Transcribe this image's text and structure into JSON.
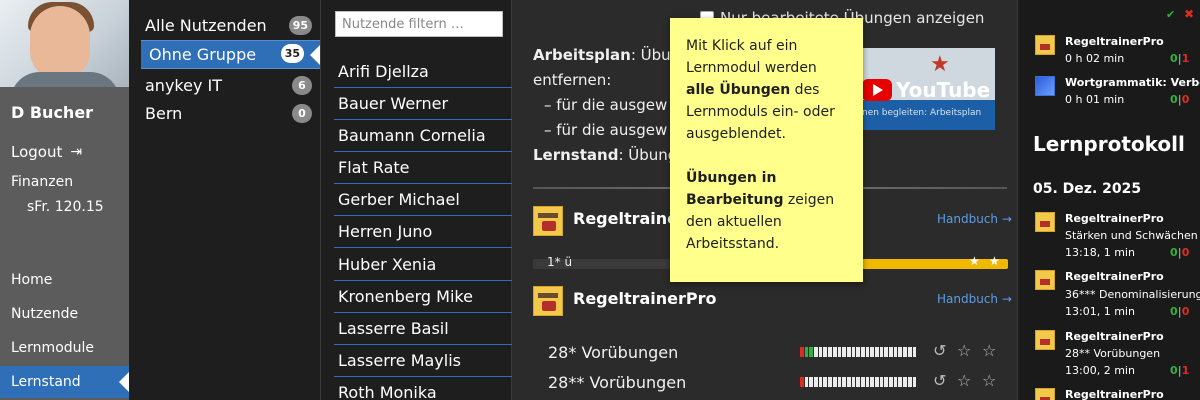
{
  "nav": {
    "user_name": "D Bucher",
    "logout_label": "Logout",
    "finance_label": "Finanzen",
    "finance_value": "sFr. 120.15",
    "items": [
      {
        "label": "Home"
      },
      {
        "label": "Nutzende"
      },
      {
        "label": "Lernmodule"
      },
      {
        "label": "Lernstand",
        "active": true
      }
    ]
  },
  "groups": {
    "items": [
      {
        "label": "Alle Nutzenden",
        "count": "95"
      },
      {
        "label": "Ohne Gruppe",
        "count": "35",
        "active": true
      },
      {
        "label": "anykey IT",
        "count": "6"
      },
      {
        "label": "Bern",
        "count": "0"
      }
    ]
  },
  "users": {
    "filter_placeholder": "Nutzende filtern …",
    "items": [
      "Arifi Djellza",
      "Bauer Werner",
      "Baumann Cornelia",
      "Flat Rate",
      "Gerber Michael",
      "Herren Juno",
      "Huber Xenia",
      "Kronenberg Mike",
      "Lasserre Basil",
      "Lasserre Maylis",
      "Roth Monika"
    ]
  },
  "main": {
    "only_edited_label": "Nur bearbeitete Übungen anzeigen",
    "plan_label": "Arbeitsplan",
    "plan_text": ": Übu",
    "plan_line2": "entfernen:",
    "plan_bullet1": "– für die ausgew",
    "plan_bullet2": "– für die ausgew",
    "lernstand_label": "Lernstand",
    "lernstand_text": ": Übung",
    "video_brand": "YouTube",
    "video_caption": "nen begleiten: Arbeitsplan",
    "modules": [
      {
        "title": "Regeltraine",
        "handbook": "Handbuch"
      },
      {
        "title": "RegeltrainerPro",
        "handbook": "Handbuch"
      }
    ],
    "partial_row_text": "1* ü",
    "exercises": [
      {
        "label": "28* Vorübungen",
        "progress": 0.12
      },
      {
        "label": "28** Vorübungen",
        "progress": 0.04
      }
    ]
  },
  "tooltip": {
    "p1_a": "Mit Klick auf ein Lernmodul werden ",
    "p1_b": "alle Übungen",
    "p1_c": " des Lernmoduls ein- oder ausgeblendet.",
    "p2_a": "Übungen in Bearbeitung",
    "p2_b": " zeigen den aktuellen Arbeitsstand."
  },
  "protocol": {
    "heading": "Lernprotokoll",
    "date": "05. Dez. 2025",
    "top_items": [
      {
        "title": "RegeltrainerPro",
        "time": "0 h 02 min",
        "correct": "0",
        "wrong": "1"
      },
      {
        "title": "Wortgrammatik: Verben",
        "time": "0 h 01 min",
        "correct": "0",
        "wrong": "0"
      }
    ],
    "entries": [
      {
        "title": "RegeltrainerPro",
        "subtitle": "Stärken und Schwächen 1",
        "time": "13:18, 1 min",
        "correct": "0",
        "wrong": "0"
      },
      {
        "title": "RegeltrainerPro",
        "subtitle": "36*** Denominalisierung",
        "time": "13:01, 1 min",
        "correct": "0",
        "wrong": "0"
      },
      {
        "title": "RegeltrainerPro",
        "subtitle": "28** Vorübungen",
        "time": "13:00, 2 min",
        "correct": "0",
        "wrong": "1"
      },
      {
        "title": "RegeltrainerPro",
        "subtitle": "",
        "time": "",
        "correct": "",
        "wrong": ""
      }
    ]
  },
  "colors": {
    "accent": "#2f6fb7",
    "tooltip_bg": "#ffff8c",
    "correct": "#2fb33b",
    "wrong": "#e02b20"
  }
}
